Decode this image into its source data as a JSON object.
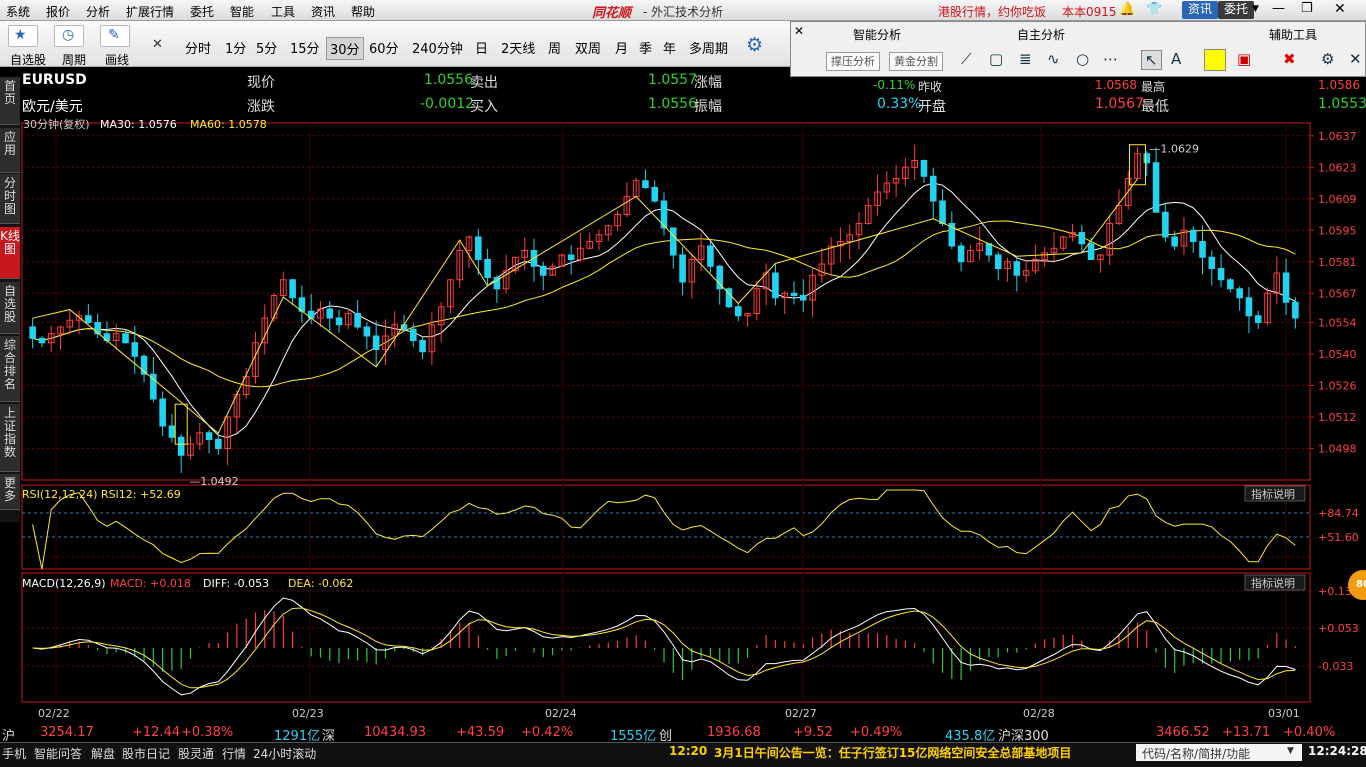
{
  "menu": {
    "items": [
      "系统",
      "报价",
      "分析",
      "扩展行情",
      "委托",
      "智能",
      "工具",
      "资讯",
      "帮助"
    ],
    "brand": "同花顺",
    "title": "- 外汇技术分析",
    "promo": "港股行情，约你吃饭",
    "version": "本本0915",
    "btn_news": "资讯",
    "btn_trade": "委托"
  },
  "toolbar": {
    "labels": [
      "自选股",
      "周期",
      "画线"
    ],
    "periods": [
      "分时",
      "1分",
      "5分",
      "15分",
      "30分",
      "60分",
      "240分钟",
      "日",
      "2天线",
      "周",
      "双周",
      "月",
      "季",
      "年",
      "多周期"
    ],
    "active_period": "30分"
  },
  "ai_panel": {
    "headers": [
      "智能分析",
      "自主分析",
      "辅助工具"
    ],
    "buttons": [
      "撑压分析",
      "黄金分割"
    ]
  },
  "sidebar": {
    "tabs": [
      "首页",
      "应用",
      "分时图",
      "K线图",
      "自选股",
      "综合排名",
      "上证指数",
      "更多"
    ]
  },
  "quote": {
    "symbol": "EURUSD",
    "name": "欧元/美元",
    "l_now": "现价",
    "now": "1.0556",
    "l_sell": "卖出",
    "sell": "1.0557",
    "l_chg_pct": "涨幅",
    "chg_pct": "-0.11%",
    "l_prev": "昨收",
    "prev": "1.0568",
    "l_high": "最高",
    "high": "1.0586",
    "l_chg": "涨跌",
    "chg": "-0.0012",
    "l_buy": "买入",
    "buy": "1.0556",
    "l_amp": "振幅",
    "amp": "0.33%",
    "l_open": "开盘",
    "open": "1.0567",
    "l_low": "最低",
    "low": "1.0553"
  },
  "chart_header": {
    "period": "30分钟(复权)",
    "ma30": "MA30: 1.0576",
    "ma60": "MA60: 1.0578"
  },
  "rsi_header": "RSI(12,12,24)  RSI12: +52.69",
  "macd_header": {
    "name": "MACD(12,26,9)",
    "macd": "MACD: +0.018",
    "diff": "DIFF: -0.053",
    "dea": "DEA: -0.062"
  },
  "explain": "指标说明",
  "chart_data": {
    "type": "candlestick",
    "y_ticks": [
      "1.0637",
      "1.0623",
      "1.0609",
      "1.0595",
      "1.0581",
      "1.0567",
      "1.0554",
      "1.0540",
      "1.0526",
      "1.0512",
      "1.0498"
    ],
    "ylim": [
      1.0484,
      1.064
    ],
    "dates": [
      "02/22",
      "02/23",
      "02/24",
      "02/27",
      "02/28",
      "03/01"
    ],
    "high_label": "1.0629",
    "low_label": "1.0492",
    "close": [
      1.0547,
      1.0545,
      1.0549,
      1.0552,
      1.0555,
      1.0557,
      1.0554,
      1.0549,
      1.0546,
      1.0549,
      1.0545,
      1.0539,
      1.0531,
      1.052,
      1.0508,
      1.0503,
      1.0495,
      1.05,
      1.0505,
      1.0502,
      1.0498,
      1.0512,
      1.0522,
      1.053,
      1.0545,
      1.0556,
      1.0566,
      1.0573,
      1.0565,
      1.0559,
      1.0556,
      1.056,
      1.0556,
      1.0553,
      1.0558,
      1.0552,
      1.0548,
      1.0542,
      1.0548,
      1.0553,
      1.0551,
      1.0546,
      1.0541,
      1.0553,
      1.0561,
      1.0573,
      1.0586,
      1.0592,
      1.0582,
      1.0574,
      1.0569,
      1.0577,
      1.0583,
      1.0586,
      1.0579,
      1.0575,
      1.0579,
      1.0584,
      1.0582,
      1.0587,
      1.059,
      1.0593,
      1.0597,
      1.0602,
      1.061,
      1.0617,
      1.0614,
      1.0608,
      1.0596,
      1.0584,
      1.0572,
      1.0582,
      1.0588,
      1.0579,
      1.0569,
      1.0561,
      1.0557,
      1.0558,
      1.0569,
      1.0576,
      1.0565,
      1.0567,
      1.0566,
      1.0564,
      1.0575,
      1.058,
      1.0588,
      1.059,
      1.0593,
      1.0598,
      1.0606,
      1.0612,
      1.0616,
      1.0618,
      1.0623,
      1.0626,
      1.0619,
      1.0608,
      1.0598,
      1.0588,
      1.0581,
      1.0586,
      1.0589,
      1.0584,
      1.0578,
      1.0581,
      1.0575,
      1.0577,
      1.0582,
      1.0585,
      1.0587,
      1.0592,
      1.0594,
      1.0589,
      1.0582,
      1.0584,
      1.0598,
      1.0606,
      1.0618,
      1.0629,
      1.0625,
      1.0603,
      1.0592,
      1.0588,
      1.0595,
      1.059,
      1.0583,
      1.0578,
      1.0573,
      1.0569,
      1.0565,
      1.0557,
      1.0554,
      1.0567,
      1.0576,
      1.0563,
      1.0556
    ]
  },
  "rsi_ticks": [
    "+84.74",
    "+51.60"
  ],
  "macd_ticks": [
    "+0.136",
    "+0.053",
    "-0.033"
  ],
  "status_bar": {
    "sh_label": "沪",
    "sh": "3254.17",
    "sh_chg": "+12.44",
    "sh_pct": "+0.38%",
    "sh_amt": "1291亿",
    "sz_label": "深",
    "sz": "10434.93",
    "sz_chg": "+43.59",
    "sz_pct": "+0.42%",
    "sz_amt": "1555亿",
    "cy_label": "创",
    "cy": "1936.68",
    "cy_chg": "+9.52",
    "cy_pct": "+0.49%",
    "cy_amt": "435.8亿",
    "hs_label": "沪深300",
    "hs": "3466.52",
    "hs_chg": "+13.71",
    "hs_pct": "+0.40%"
  },
  "bottom_bar": {
    "items": [
      "手机",
      "智能问答",
      "解盘",
      "股市日记",
      "股灵通",
      "行情",
      "24小时滚动"
    ],
    "ticker_time": "12:20",
    "ticker": "3月1日午间公告一览：任子行签订15亿网络空间安全总部基地项目",
    "code_box": "代码/名称/简拼/功能",
    "clock": "12:24:28"
  },
  "float_badge": "80",
  "colors": {
    "up": "#ff3c3c",
    "down": "#21d3f0",
    "ma1": "#ffffff",
    "ma2": "#ffea2a",
    "grid": "#6b0000",
    "axis": "#c8181e"
  }
}
